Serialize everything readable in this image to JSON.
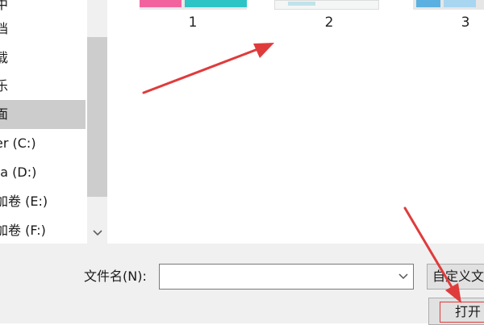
{
  "nav": {
    "items": [
      {
        "label": "档",
        "selected": false
      },
      {
        "label": "载",
        "selected": false
      },
      {
        "label": "乐",
        "selected": false
      },
      {
        "label": "面",
        "selected": true
      },
      {
        "label": "er (C:)",
        "selected": false
      },
      {
        "label": "ta (D:)",
        "selected": false
      },
      {
        "label": "加卷 (E:)",
        "selected": false
      },
      {
        "label": "加卷 (F:)",
        "selected": false
      }
    ],
    "scroll_down_icon": "chevron-down-icon"
  },
  "files": {
    "items": [
      {
        "label": "1"
      },
      {
        "label": "2"
      },
      {
        "label": "3"
      }
    ]
  },
  "footer": {
    "filename_label": "文件名(N):",
    "filename_value": "",
    "filter_label": "自定义文",
    "open_label": "打开"
  },
  "colors": {
    "annotation_arrow": "#e03b3b",
    "selected_nav": "#cccccc",
    "footer_bg": "#f0f0f0"
  }
}
